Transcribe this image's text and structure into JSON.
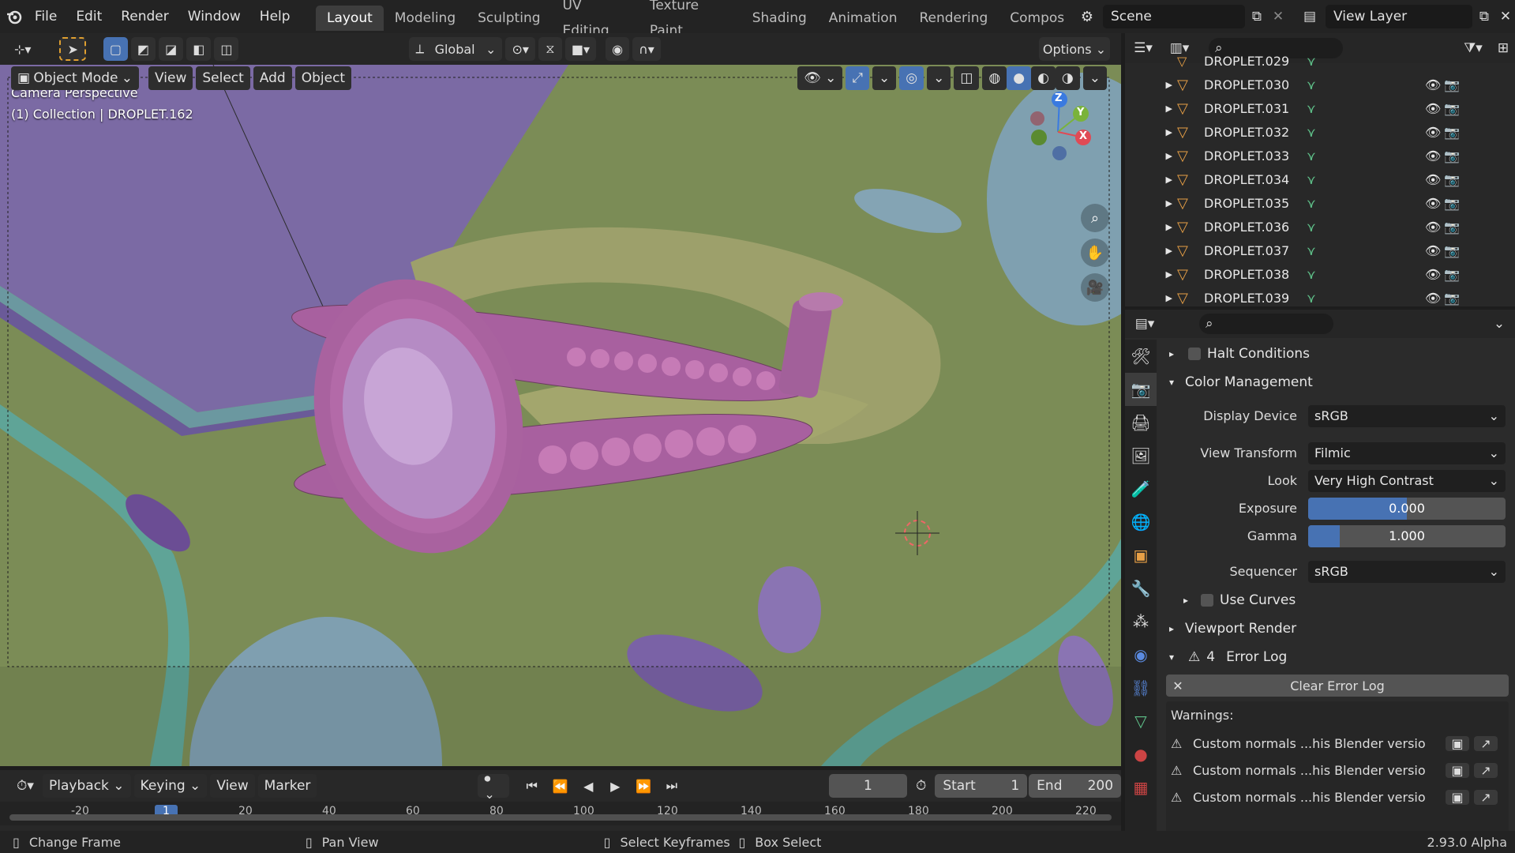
{
  "menu": {
    "file": "File",
    "edit": "Edit",
    "render": "Render",
    "window": "Window",
    "help": "Help"
  },
  "workspaces": [
    "Layout",
    "Modeling",
    "Sculpting",
    "UV Editing",
    "Texture Paint",
    "Shading",
    "Animation",
    "Rendering",
    "Composit"
  ],
  "scene": "Scene",
  "view_layer": "View Layer",
  "toolbar": {
    "orientation": "Global",
    "options": "Options"
  },
  "viewport_header": {
    "mode": "Object Mode",
    "view": "View",
    "select": "Select",
    "add": "Add",
    "object": "Object"
  },
  "viewport_overlay": {
    "line1": "Camera Perspective",
    "line2": "(1) Collection | DROPLET.162"
  },
  "gizmo": {
    "z": "Z",
    "y": "Y",
    "x": "X"
  },
  "outliner": {
    "partial_top": "DROPLET.029",
    "items": [
      "DROPLET.030",
      "DROPLET.031",
      "DROPLET.032",
      "DROPLET.033",
      "DROPLET.034",
      "DROPLET.035",
      "DROPLET.036",
      "DROPLET.037",
      "DROPLET.038",
      "DROPLET.039"
    ]
  },
  "properties": {
    "halt": "Halt Conditions",
    "color_mgmt": "Color Management",
    "display_device_label": "Display Device",
    "display_device": "sRGB",
    "view_transform_label": "View Transform",
    "view_transform": "Filmic",
    "look_label": "Look",
    "look": "Very High Contrast",
    "exposure_label": "Exposure",
    "exposure": "0.000",
    "exposure_fill": 0.5,
    "gamma_label": "Gamma",
    "gamma": "1.000",
    "gamma_fill": 0.16,
    "sequencer_label": "Sequencer",
    "sequencer": "sRGB",
    "use_curves": "Use Curves",
    "viewport_render": "Viewport Render",
    "error_count": "4",
    "error_log": "Error Log",
    "clear_error_log": "Clear Error Log",
    "warnings_label": "Warnings:",
    "warnings": [
      "Custom normals ...his Blender versio",
      "Custom normals ...his Blender versio",
      "Custom normals ...his Blender versio"
    ]
  },
  "timeline": {
    "playback": "Playback",
    "keying": "Keying",
    "view": "View",
    "marker": "Marker",
    "current_frame": "1",
    "start_label": "Start",
    "start": "1",
    "end_label": "End",
    "end": "200",
    "ruler": [
      "-20",
      "1",
      "20",
      "40",
      "60",
      "80",
      "100",
      "120",
      "140",
      "160",
      "180",
      "200",
      "220"
    ]
  },
  "statusbar": {
    "change_frame": "Change Frame",
    "pan_view": "Pan View",
    "select_keyframes": "Select Keyframes",
    "box_select": "Box Select",
    "version": "2.93.0 Alpha"
  },
  "colors": {
    "accent": "#4772b3",
    "mesh_orange": "#e8a046",
    "mesh_green": "#5fc28a"
  }
}
